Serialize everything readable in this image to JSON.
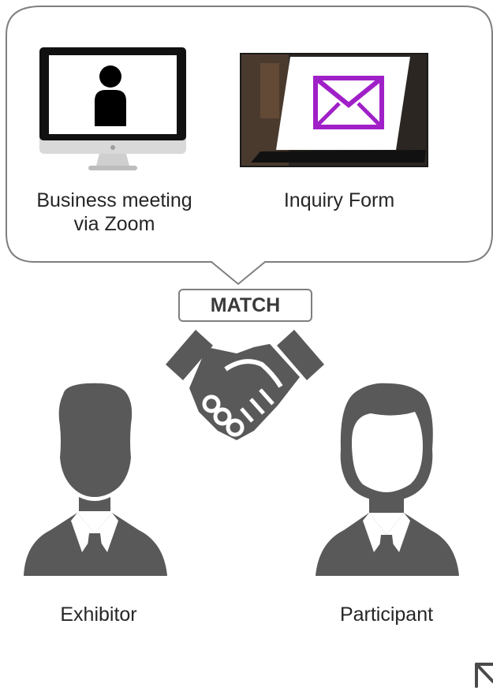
{
  "features": {
    "zoom_label": "Business meeting\nvia Zoom",
    "inquiry_label": "Inquiry Form"
  },
  "match_label": "MATCH",
  "roles": {
    "exhibitor": "Exhibitor",
    "participant": "Participant"
  },
  "colors": {
    "figure_fill": "#595959",
    "bubble_border": "#7f7f7f",
    "envelope": "#a020c8",
    "text": "#262626"
  }
}
